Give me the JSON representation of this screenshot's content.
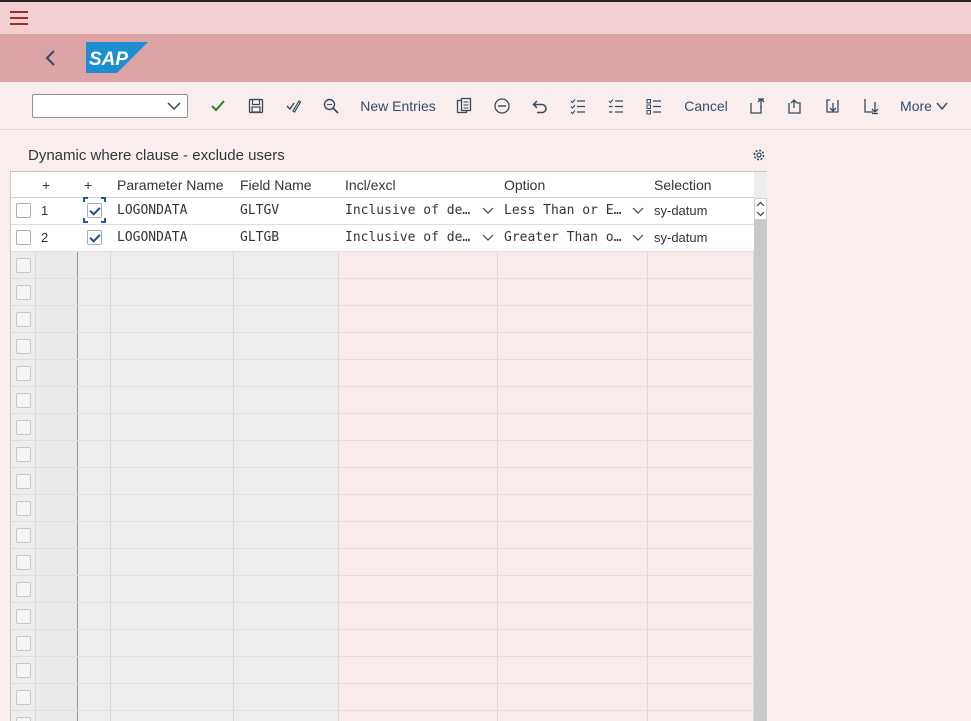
{
  "shell": {
    "menu_icon": "hamburger-menu-icon",
    "back_icon": "chevron-left-icon",
    "logo_text": "SAP",
    "colors": {
      "topbar": "#f3d1d3",
      "shellbar": "#dca4a5",
      "accent": "#2e4d6b",
      "logo_blue": "#1c8ed1"
    }
  },
  "toolbar": {
    "select_value": "",
    "confirm_icon": "checkmark-icon",
    "save_icon": "save-icon",
    "check_icon": "check-syntax-icon",
    "find_icon": "find-icon",
    "new_entries": "New Entries",
    "copy_icon": "copy-icon",
    "delete_icon": "delete-icon",
    "undo_icon": "undo-icon",
    "select_all_icon": "select-all-icon",
    "deselect_all_icon": "deselect-all-icon",
    "select_block_icon": "select-block-icon",
    "cancel": "Cancel",
    "first_page_icon": "first-page-icon",
    "prev_page_icon": "previous-page-icon",
    "next_page_icon": "next-page-icon",
    "last_page_icon": "last-page-icon",
    "more": "More"
  },
  "panel": {
    "title": "Dynamic where clause - exclude users",
    "settings_icon": "gear-icon"
  },
  "table": {
    "headers": {
      "row_plus": "+",
      "sel_plus": "+",
      "param": "Parameter Name",
      "field": "Field Name",
      "incl": "Incl/excl",
      "option": "Option",
      "selection": "Selection"
    },
    "rows": [
      {
        "num": "1",
        "checked": true,
        "param": "LOGONDATA",
        "field": "GLTGV",
        "incl": "Inclusive of de…",
        "option": "Less Than or E…",
        "selection": "sy-datum"
      },
      {
        "num": "2",
        "checked": true,
        "param": "LOGONDATA",
        "field": "GLTGB",
        "incl": "Inclusive of de…",
        "option": "Greater Than o…",
        "selection": "sy-datum"
      }
    ],
    "empty_rows": 18
  }
}
